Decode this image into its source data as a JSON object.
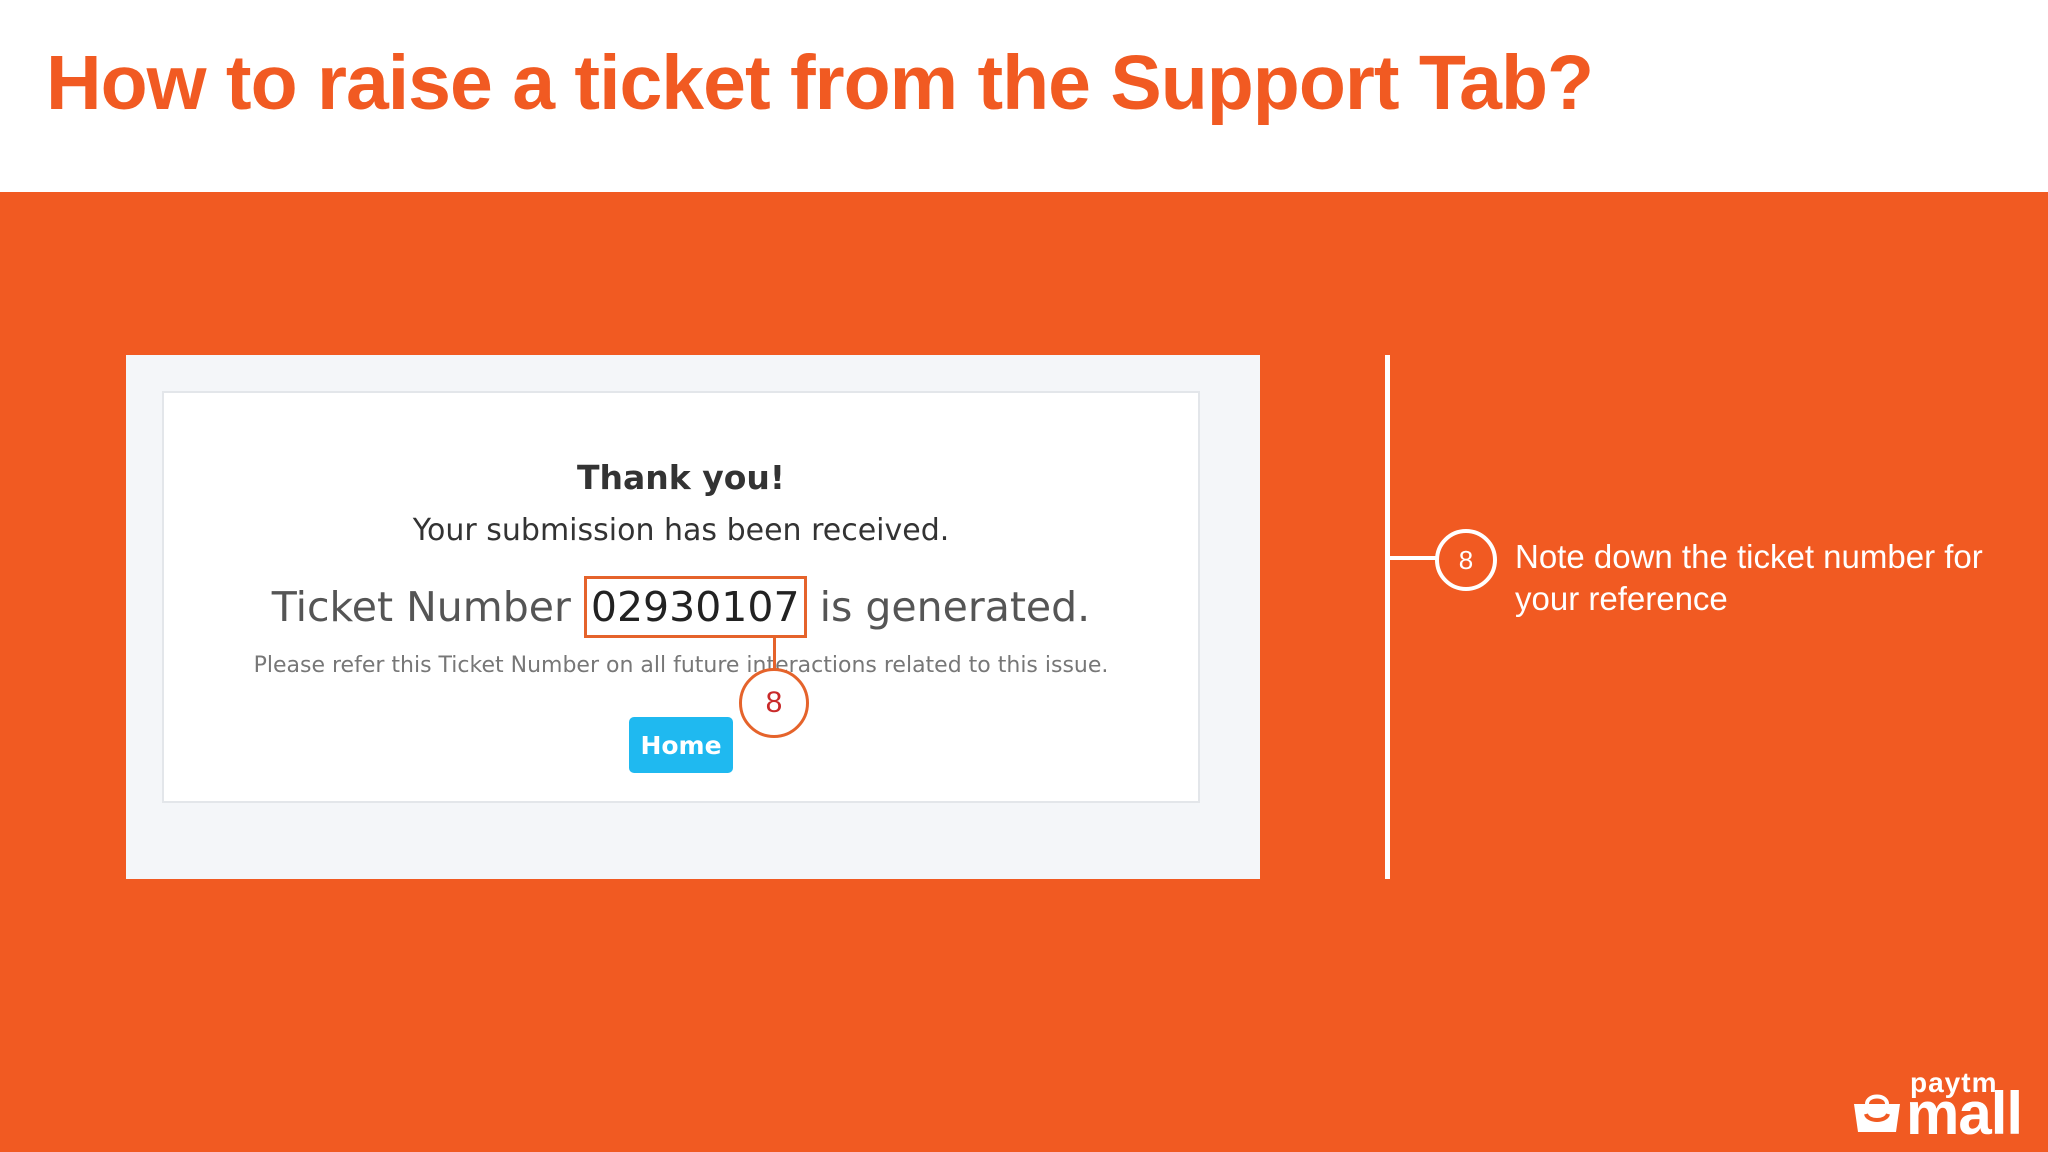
{
  "slide": {
    "title": "How to raise a ticket from the Support Tab?"
  },
  "screenshot": {
    "heading": "Thank you!",
    "submission_text": "Your submission has been received.",
    "ticket_prefix": "Ticket Number",
    "ticket_number": "02930107",
    "ticket_suffix": "is generated.",
    "refer_text": "Please refer this Ticket Number on all future interactions related to this issue.",
    "home_button_label": "Home",
    "callout_number": "8"
  },
  "step": {
    "number": "8",
    "text": "Note down the ticket number for your reference"
  },
  "logo": {
    "small_text": "paytm",
    "big_text": "mall"
  },
  "colors": {
    "brand_orange": "#f15a22",
    "highlight_border": "#e5632b",
    "home_button": "#1fb9f0",
    "callout_number": "#c92a2a"
  }
}
